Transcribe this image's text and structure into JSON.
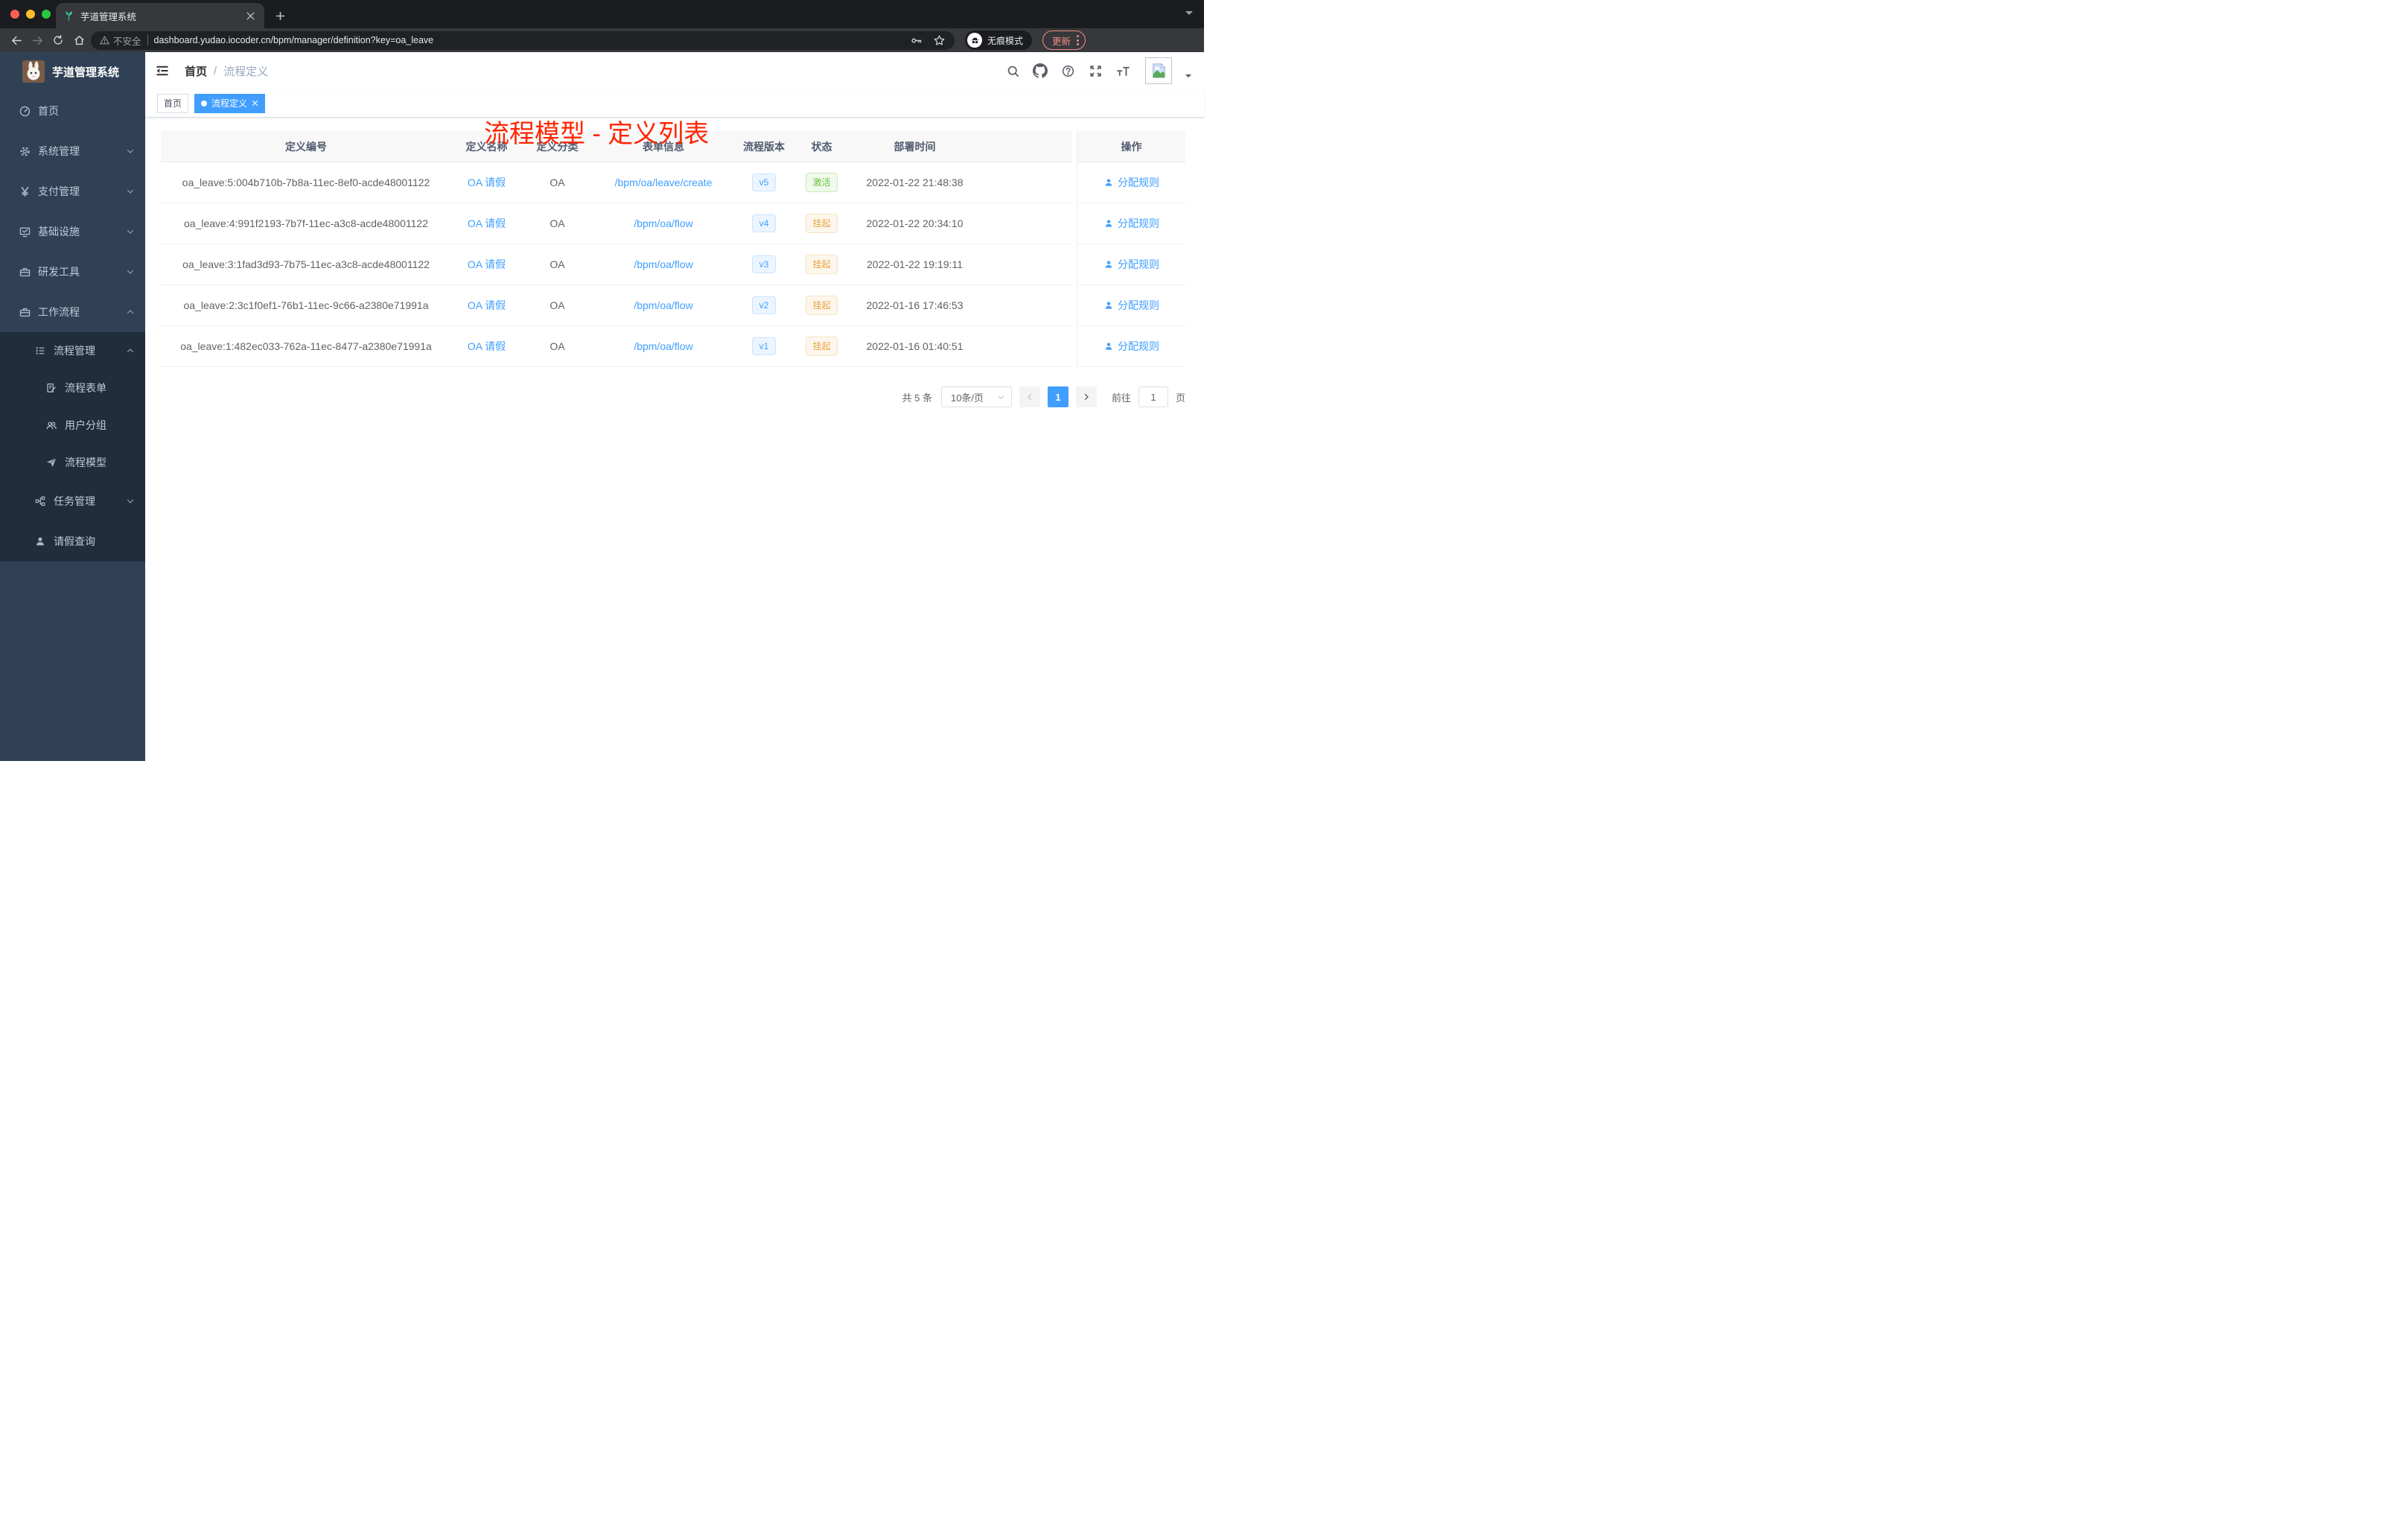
{
  "browser": {
    "tab_title": "芋道管理系统",
    "security_label": "不安全",
    "url": "dashboard.yudao.iocoder.cn/bpm/manager/definition?key=oa_leave",
    "incognito_label": "无痕模式",
    "update_label": "更新"
  },
  "sidebar": {
    "title": "芋道管理系统",
    "items": [
      {
        "label": "首页"
      },
      {
        "label": "系统管理"
      },
      {
        "label": "支付管理"
      },
      {
        "label": "基础设施"
      },
      {
        "label": "研发工具"
      },
      {
        "label": "工作流程",
        "children": [
          {
            "label": "流程管理",
            "children": [
              {
                "label": "流程表单"
              },
              {
                "label": "用户分组"
              },
              {
                "label": "流程模型"
              }
            ]
          },
          {
            "label": "任务管理"
          },
          {
            "label": "请假查询"
          }
        ]
      }
    ]
  },
  "header": {
    "breadcrumb": [
      "首页",
      "流程定义"
    ],
    "breadcrumb_separator": "/",
    "annotation": "流程模型 - 定义列表"
  },
  "tags": [
    {
      "label": "首页",
      "active": false
    },
    {
      "label": "流程定义",
      "active": true
    }
  ],
  "table": {
    "columns": [
      "定义编号",
      "定义名称",
      "定义分类",
      "表单信息",
      "流程版本",
      "状态",
      "部署时间",
      "操作"
    ],
    "rows": [
      {
        "id": "oa_leave:5:004b710b-7b8a-11ec-8ef0-acde48001122",
        "name": "OA 请假",
        "category": "OA",
        "form": "/bpm/oa/leave/create",
        "version": "v5",
        "status": "激活",
        "time": "2022-01-22 21:48:38",
        "action": "分配规则"
      },
      {
        "id": "oa_leave:4:991f2193-7b7f-11ec-a3c8-acde48001122",
        "name": "OA 请假",
        "category": "OA",
        "form": "/bpm/oa/flow",
        "version": "v4",
        "status": "挂起",
        "time": "2022-01-22 20:34:10",
        "action": "分配规则"
      },
      {
        "id": "oa_leave:3:1fad3d93-7b75-11ec-a3c8-acde48001122",
        "name": "OA 请假",
        "category": "OA",
        "form": "/bpm/oa/flow",
        "version": "v3",
        "status": "挂起",
        "time": "2022-01-22 19:19:11",
        "action": "分配规则"
      },
      {
        "id": "oa_leave:2:3c1f0ef1-76b1-11ec-9c66-a2380e71991a",
        "name": "OA 请假",
        "category": "OA",
        "form": "/bpm/oa/flow",
        "version": "v2",
        "status": "挂起",
        "time": "2022-01-16 17:46:53",
        "action": "分配规则"
      },
      {
        "id": "oa_leave:1:482ec033-762a-11ec-8477-a2380e71991a",
        "name": "OA 请假",
        "category": "OA",
        "form": "/bpm/oa/flow",
        "version": "v1",
        "status": "挂起",
        "time": "2022-01-16 01:40:51",
        "action": "分配规则"
      }
    ]
  },
  "pagination": {
    "total": "共 5 条",
    "page_size": "10条/页",
    "current_page": "1",
    "goto_label": "前往",
    "goto_value": "1",
    "page_unit": "页"
  },
  "icons": {
    "favicon": "green-seedling",
    "sidebar": [
      "dashboard",
      "gear",
      "yen",
      "monitor-check",
      "toolbox",
      "briefcase",
      "list-tree",
      "form-edit",
      "users",
      "paper-plane",
      "org-tree",
      "person"
    ],
    "header": [
      "fold-menu",
      "search",
      "github",
      "help-circle",
      "fullscreen",
      "font-size",
      "broken-image-avatar"
    ]
  },
  "colors": {
    "accent_blue": "#409eff",
    "sidebar_bg": "#304156",
    "submenu_bg": "#1f2d3d",
    "status_active_green": "#67c23a",
    "status_suspend_orange": "#e6a23c",
    "annotation_red": "#ff2600",
    "update_salmon": "#f28b82"
  }
}
